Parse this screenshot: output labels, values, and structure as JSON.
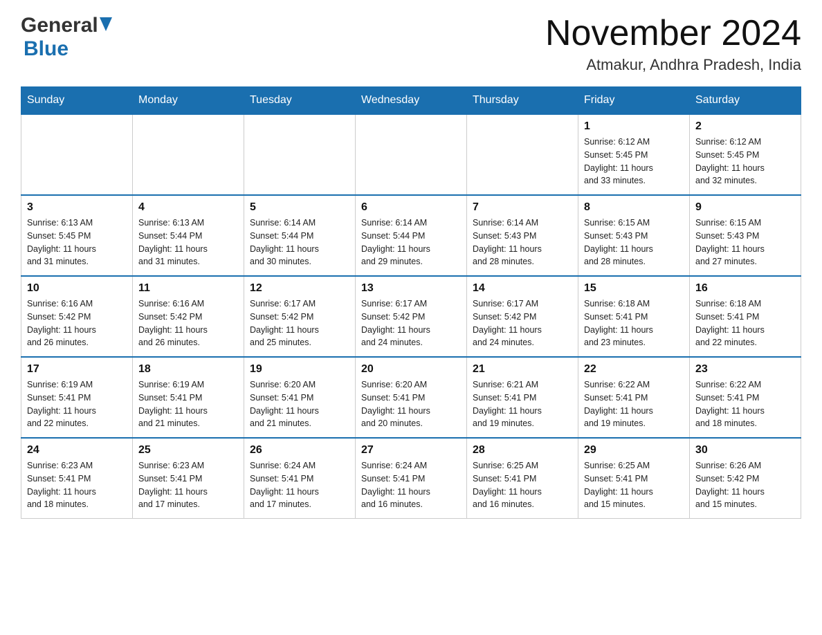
{
  "header": {
    "logo_general": "General",
    "logo_blue": "Blue",
    "month_title": "November 2024",
    "location": "Atmakur, Andhra Pradesh, India"
  },
  "days_of_week": [
    "Sunday",
    "Monday",
    "Tuesday",
    "Wednesday",
    "Thursday",
    "Friday",
    "Saturday"
  ],
  "weeks": [
    [
      {
        "day": "",
        "info": ""
      },
      {
        "day": "",
        "info": ""
      },
      {
        "day": "",
        "info": ""
      },
      {
        "day": "",
        "info": ""
      },
      {
        "day": "",
        "info": ""
      },
      {
        "day": "1",
        "info": "Sunrise: 6:12 AM\nSunset: 5:45 PM\nDaylight: 11 hours\nand 33 minutes."
      },
      {
        "day": "2",
        "info": "Sunrise: 6:12 AM\nSunset: 5:45 PM\nDaylight: 11 hours\nand 32 minutes."
      }
    ],
    [
      {
        "day": "3",
        "info": "Sunrise: 6:13 AM\nSunset: 5:45 PM\nDaylight: 11 hours\nand 31 minutes."
      },
      {
        "day": "4",
        "info": "Sunrise: 6:13 AM\nSunset: 5:44 PM\nDaylight: 11 hours\nand 31 minutes."
      },
      {
        "day": "5",
        "info": "Sunrise: 6:14 AM\nSunset: 5:44 PM\nDaylight: 11 hours\nand 30 minutes."
      },
      {
        "day": "6",
        "info": "Sunrise: 6:14 AM\nSunset: 5:44 PM\nDaylight: 11 hours\nand 29 minutes."
      },
      {
        "day": "7",
        "info": "Sunrise: 6:14 AM\nSunset: 5:43 PM\nDaylight: 11 hours\nand 28 minutes."
      },
      {
        "day": "8",
        "info": "Sunrise: 6:15 AM\nSunset: 5:43 PM\nDaylight: 11 hours\nand 28 minutes."
      },
      {
        "day": "9",
        "info": "Sunrise: 6:15 AM\nSunset: 5:43 PM\nDaylight: 11 hours\nand 27 minutes."
      }
    ],
    [
      {
        "day": "10",
        "info": "Sunrise: 6:16 AM\nSunset: 5:42 PM\nDaylight: 11 hours\nand 26 minutes."
      },
      {
        "day": "11",
        "info": "Sunrise: 6:16 AM\nSunset: 5:42 PM\nDaylight: 11 hours\nand 26 minutes."
      },
      {
        "day": "12",
        "info": "Sunrise: 6:17 AM\nSunset: 5:42 PM\nDaylight: 11 hours\nand 25 minutes."
      },
      {
        "day": "13",
        "info": "Sunrise: 6:17 AM\nSunset: 5:42 PM\nDaylight: 11 hours\nand 24 minutes."
      },
      {
        "day": "14",
        "info": "Sunrise: 6:17 AM\nSunset: 5:42 PM\nDaylight: 11 hours\nand 24 minutes."
      },
      {
        "day": "15",
        "info": "Sunrise: 6:18 AM\nSunset: 5:41 PM\nDaylight: 11 hours\nand 23 minutes."
      },
      {
        "day": "16",
        "info": "Sunrise: 6:18 AM\nSunset: 5:41 PM\nDaylight: 11 hours\nand 22 minutes."
      }
    ],
    [
      {
        "day": "17",
        "info": "Sunrise: 6:19 AM\nSunset: 5:41 PM\nDaylight: 11 hours\nand 22 minutes."
      },
      {
        "day": "18",
        "info": "Sunrise: 6:19 AM\nSunset: 5:41 PM\nDaylight: 11 hours\nand 21 minutes."
      },
      {
        "day": "19",
        "info": "Sunrise: 6:20 AM\nSunset: 5:41 PM\nDaylight: 11 hours\nand 21 minutes."
      },
      {
        "day": "20",
        "info": "Sunrise: 6:20 AM\nSunset: 5:41 PM\nDaylight: 11 hours\nand 20 minutes."
      },
      {
        "day": "21",
        "info": "Sunrise: 6:21 AM\nSunset: 5:41 PM\nDaylight: 11 hours\nand 19 minutes."
      },
      {
        "day": "22",
        "info": "Sunrise: 6:22 AM\nSunset: 5:41 PM\nDaylight: 11 hours\nand 19 minutes."
      },
      {
        "day": "23",
        "info": "Sunrise: 6:22 AM\nSunset: 5:41 PM\nDaylight: 11 hours\nand 18 minutes."
      }
    ],
    [
      {
        "day": "24",
        "info": "Sunrise: 6:23 AM\nSunset: 5:41 PM\nDaylight: 11 hours\nand 18 minutes."
      },
      {
        "day": "25",
        "info": "Sunrise: 6:23 AM\nSunset: 5:41 PM\nDaylight: 11 hours\nand 17 minutes."
      },
      {
        "day": "26",
        "info": "Sunrise: 6:24 AM\nSunset: 5:41 PM\nDaylight: 11 hours\nand 17 minutes."
      },
      {
        "day": "27",
        "info": "Sunrise: 6:24 AM\nSunset: 5:41 PM\nDaylight: 11 hours\nand 16 minutes."
      },
      {
        "day": "28",
        "info": "Sunrise: 6:25 AM\nSunset: 5:41 PM\nDaylight: 11 hours\nand 16 minutes."
      },
      {
        "day": "29",
        "info": "Sunrise: 6:25 AM\nSunset: 5:41 PM\nDaylight: 11 hours\nand 15 minutes."
      },
      {
        "day": "30",
        "info": "Sunrise: 6:26 AM\nSunset: 5:42 PM\nDaylight: 11 hours\nand 15 minutes."
      }
    ]
  ]
}
